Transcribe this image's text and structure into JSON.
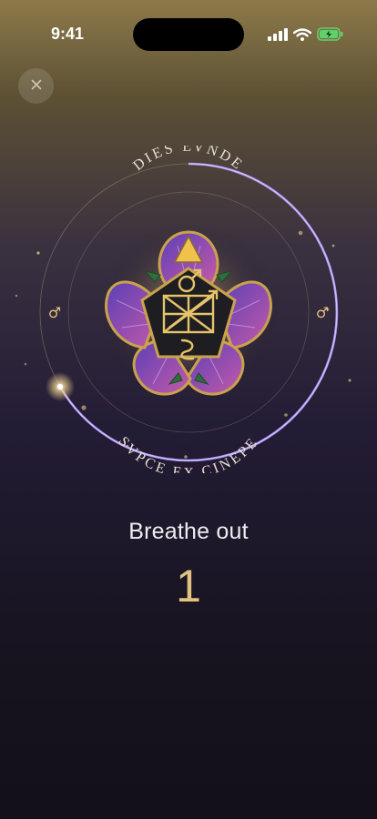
{
  "status_bar": {
    "time": "9:41",
    "icons": [
      "cellular-signal-icon",
      "wifi-icon",
      "battery-charging-icon"
    ]
  },
  "close_button": {
    "icon": "close-icon"
  },
  "ritual": {
    "top_inscription": "DIES LVNDE",
    "bottom_inscription": "SVPCE EX CINEPE",
    "left_symbol": "♂",
    "right_symbol": "♂",
    "progress_fraction": 0.6
  },
  "breath": {
    "instruction": "Breathe out",
    "count": "1"
  },
  "colors": {
    "accent_gold": "#e2c27f",
    "progress_violet": "#b79cff",
    "petal_violet": "#7a4fc9",
    "petal_pink": "#c45aa8"
  }
}
